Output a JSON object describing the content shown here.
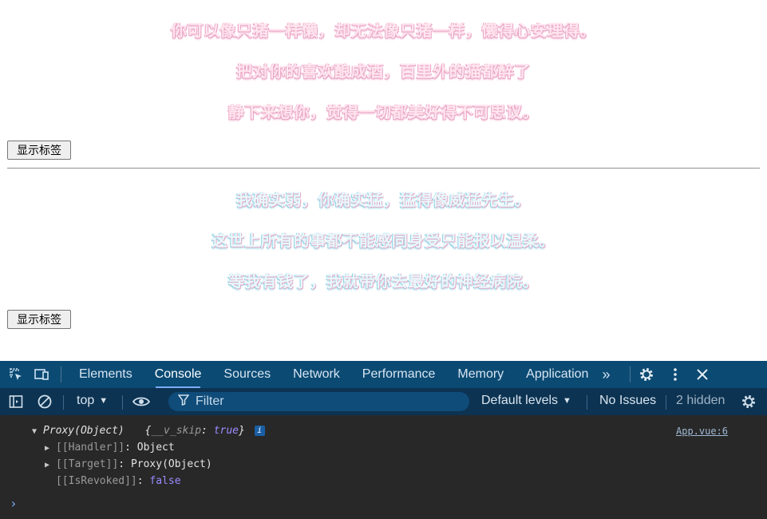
{
  "page": {
    "lines_group1": [
      "你可以像只猪一样懒，却无法像只猪一样，懒得心安理得。",
      "把对你的喜欢酿成酒，百里外的猫都醉了",
      "静下来想你，觉得一切都美好得不可思议。"
    ],
    "lines_group2": [
      "我确实弱，你确实猛，猛得像威猛先生。",
      "这世上所有的事都不能感同身受只能报以温柔。",
      "等我有钱了，我就带你去最好的神经病院。"
    ],
    "button1_label": "显示标签",
    "button2_label": "显示标签"
  },
  "devtools": {
    "tabs": [
      "Elements",
      "Console",
      "Sources",
      "Network",
      "Performance",
      "Memory",
      "Application"
    ],
    "active_tab": "Console",
    "more_tabs_icon": "chevron-double-right-icon",
    "filter": {
      "context": "top",
      "placeholder": "Filter",
      "levels": "Default levels",
      "issues": "No Issues",
      "hidden": "2 hidden"
    },
    "console": {
      "entry_title": "Proxy(Object)",
      "entry_preview_open": "{",
      "entry_preview_key": "__v_skip",
      "entry_preview_colon": ":",
      "entry_preview_val": "true",
      "entry_preview_close": "}",
      "source": "App.vue:6",
      "rows": [
        {
          "key": "[[Handler]]",
          "sep": ": ",
          "value": "Object"
        },
        {
          "key": "[[Target]]",
          "sep": ": ",
          "value": "Proxy(Object)"
        },
        {
          "key": "[[IsRevoked]]",
          "sep": ": ",
          "value": "false"
        }
      ],
      "prompt": "›"
    }
  }
}
